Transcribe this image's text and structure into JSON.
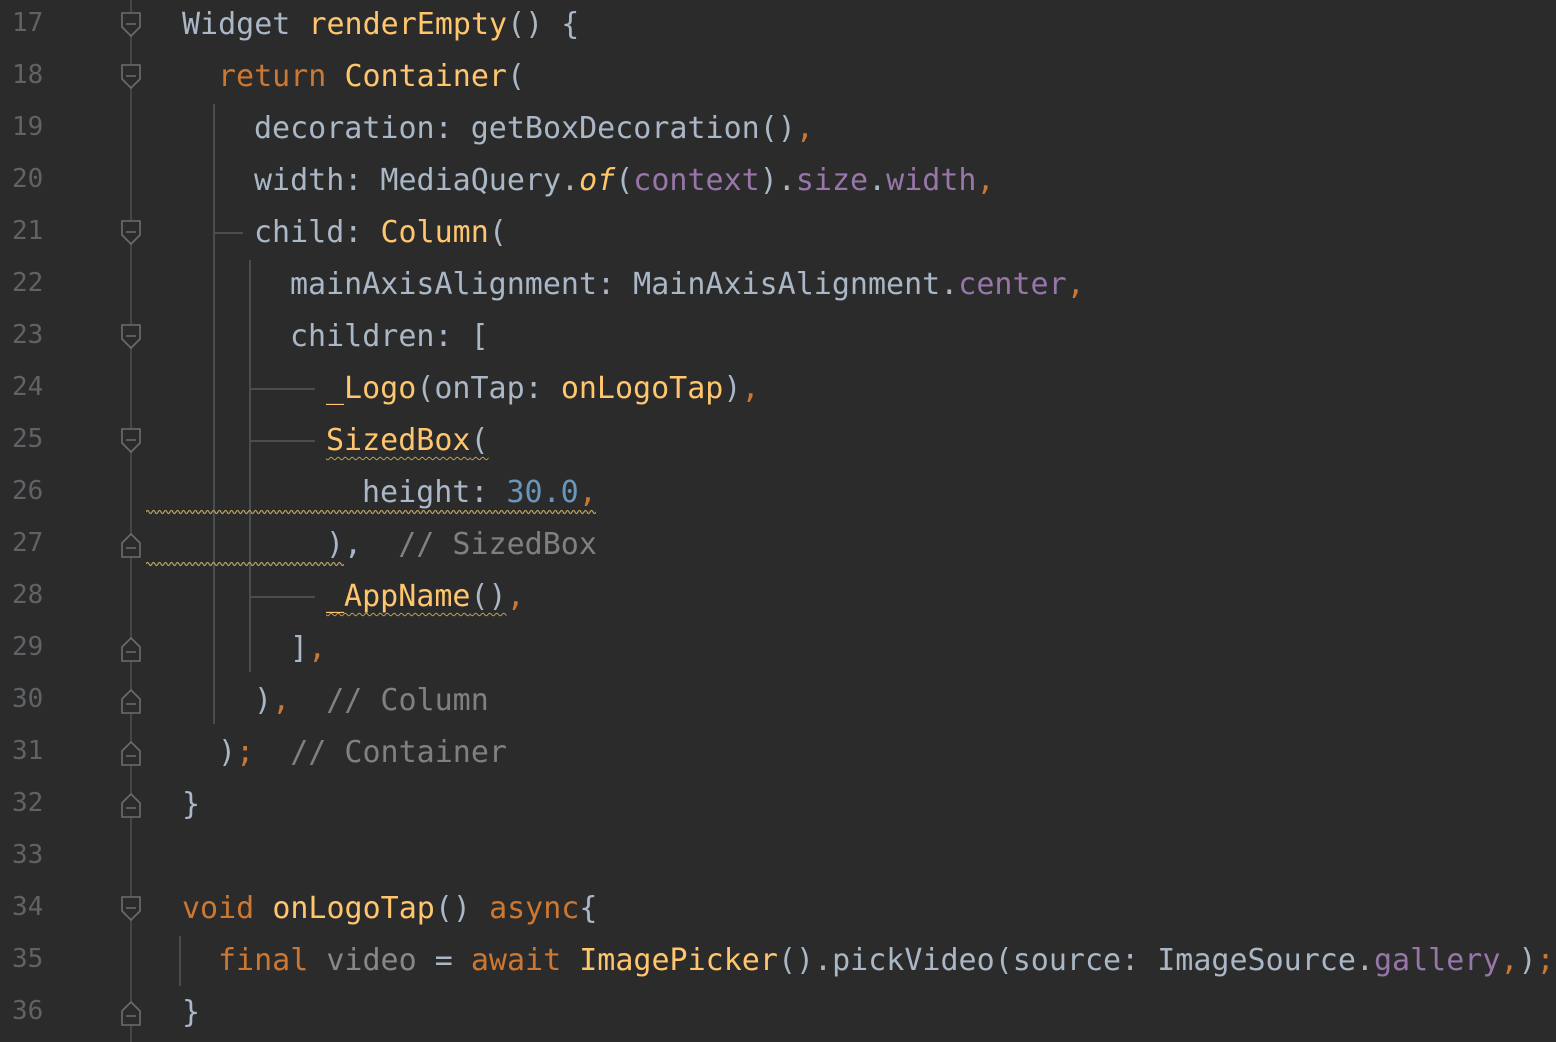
{
  "lines": [
    {
      "n": "17",
      "tokens": [
        [
          "cls",
          "Widget "
        ],
        [
          "fn",
          "renderEmpty"
        ],
        [
          "cls",
          "() {"
        ]
      ]
    },
    {
      "n": "18",
      "tokens": [
        [
          "kw",
          "return "
        ],
        [
          "fn",
          "Container"
        ],
        [
          "cls",
          "("
        ]
      ]
    },
    {
      "n": "19",
      "tokens": [
        [
          "cls",
          "decoration: getBoxDecoration()"
        ],
        [
          "punc",
          ","
        ]
      ]
    },
    {
      "n": "20",
      "tokens": [
        [
          "cls",
          "width: MediaQuery."
        ],
        [
          "italic",
          "of"
        ],
        [
          "cls",
          "("
        ],
        [
          "prop",
          "context"
        ],
        [
          "cls",
          ")."
        ],
        [
          "prop",
          "size"
        ],
        [
          "cls",
          "."
        ],
        [
          "prop",
          "width"
        ],
        [
          "punc",
          ","
        ]
      ]
    },
    {
      "n": "21",
      "tokens": [
        [
          "cls",
          "child: "
        ],
        [
          "fn",
          "Column"
        ],
        [
          "cls",
          "("
        ]
      ]
    },
    {
      "n": "22",
      "tokens": [
        [
          "cls",
          "mainAxisAlignment: MainAxisAlignment."
        ],
        [
          "prop",
          "center"
        ],
        [
          "punc",
          ","
        ]
      ]
    },
    {
      "n": "23",
      "tokens": [
        [
          "cls",
          "children: ["
        ]
      ]
    },
    {
      "n": "24",
      "tokens": [
        [
          "fn",
          "_Logo"
        ],
        [
          "cls",
          "(onTap: "
        ],
        [
          "fn",
          "onLogoTap"
        ],
        [
          "cls",
          ")"
        ],
        [
          "punc",
          ","
        ]
      ]
    },
    {
      "n": "25",
      "tokens": [
        [
          "fn warn",
          "SizedBox"
        ],
        [
          "cls warn",
          "("
        ]
      ]
    },
    {
      "n": "26",
      "tokens": [
        [
          "cls",
          "height: "
        ],
        [
          "num",
          "30.0"
        ],
        [
          "punc",
          ","
        ]
      ]
    },
    {
      "n": "27",
      "tokens": [
        [
          "cls",
          "),"
        ],
        [
          "cmt",
          "  // SizedBox"
        ]
      ]
    },
    {
      "n": "28",
      "tokens": [
        [
          "fn warn",
          "_AppName"
        ],
        [
          "cls warn",
          "()"
        ],
        [
          "punc",
          ","
        ]
      ]
    },
    {
      "n": "29",
      "tokens": [
        [
          "cls",
          "]"
        ],
        [
          "punc",
          ","
        ]
      ]
    },
    {
      "n": "30",
      "tokens": [
        [
          "cls",
          ")"
        ],
        [
          "punc",
          ","
        ],
        [
          "cmt",
          "  // Column"
        ]
      ]
    },
    {
      "n": "31",
      "tokens": [
        [
          "cls",
          ")"
        ],
        [
          "punc",
          ";"
        ],
        [
          "cmt",
          "  // Container"
        ]
      ]
    },
    {
      "n": "32",
      "tokens": [
        [
          "cls",
          "}"
        ]
      ]
    },
    {
      "n": "33",
      "tokens": []
    },
    {
      "n": "34",
      "tokens": [
        [
          "kw",
          "void "
        ],
        [
          "fn",
          "onLogoTap"
        ],
        [
          "cls",
          "() "
        ],
        [
          "kw",
          "async"
        ],
        [
          "cls",
          "{"
        ]
      ]
    },
    {
      "n": "35",
      "tokens": [
        [
          "kw",
          "final "
        ],
        [
          "dim",
          "video"
        ],
        [
          "cls",
          " = "
        ],
        [
          "kw",
          "await "
        ],
        [
          "fn",
          "ImagePicker"
        ],
        [
          "cls",
          "().pickVideo(source: ImageSource."
        ],
        [
          "prop",
          "gallery"
        ],
        [
          "punc",
          ","
        ],
        [
          "cls",
          ")"
        ],
        [
          "punc",
          ";"
        ]
      ]
    },
    {
      "n": "36",
      "tokens": [
        [
          "cls",
          "}"
        ]
      ]
    }
  ]
}
